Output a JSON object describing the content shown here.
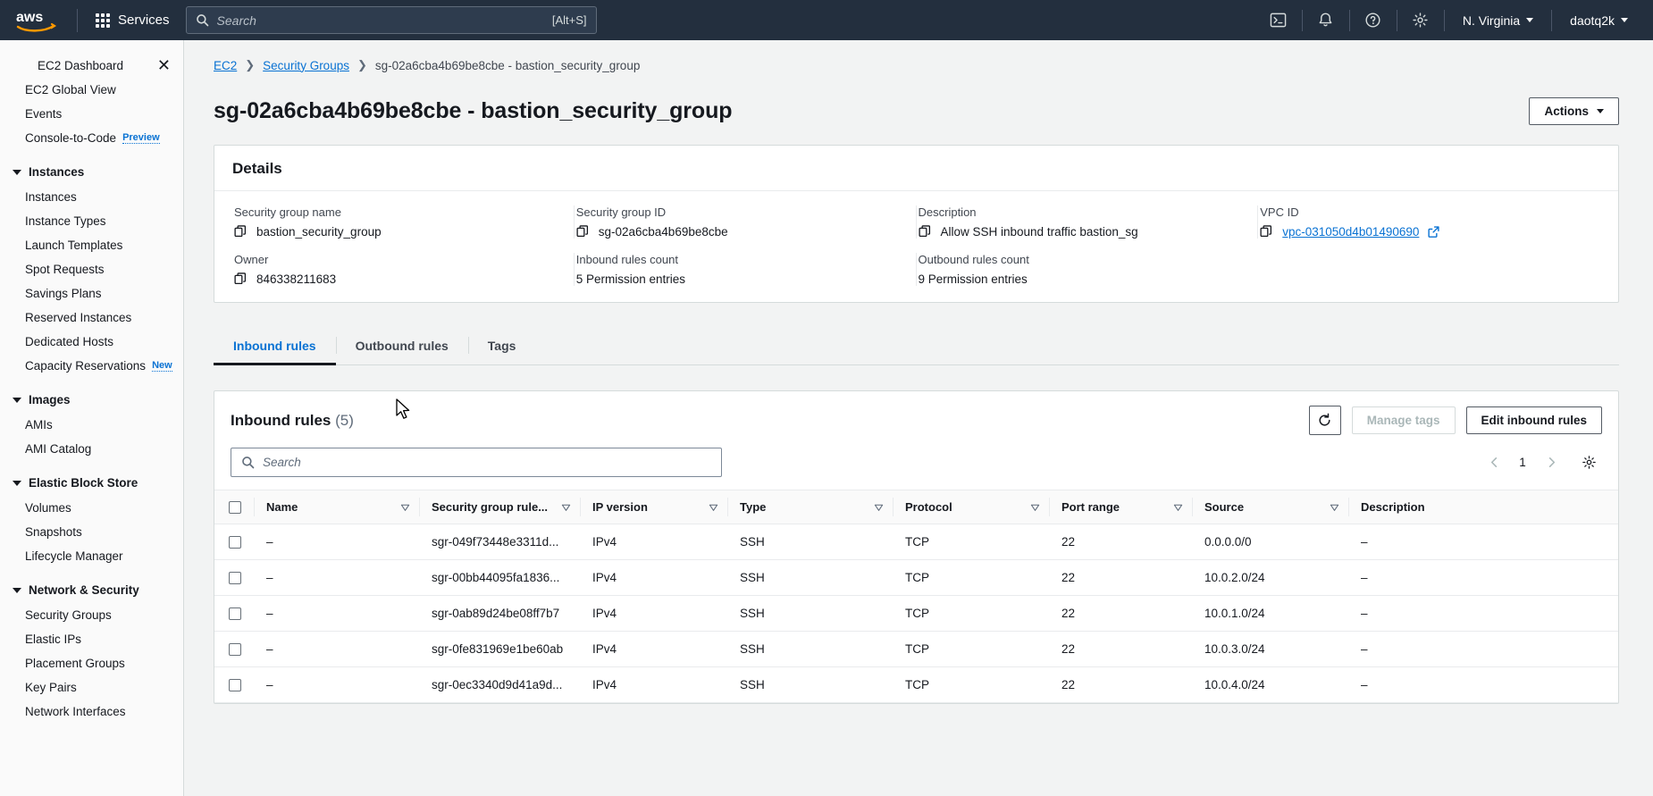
{
  "topnav": {
    "logo_alt": "aws",
    "services_label": "Services",
    "search_placeholder": "Search",
    "search_value": "",
    "search_shortcut": "[Alt+S]",
    "icons": [
      "cloudshell-icon",
      "notifications-bell-icon",
      "help-question-icon",
      "settings-gear-icon"
    ],
    "region_label": "N. Virginia",
    "account_label": "daotq2k"
  },
  "sidebar": {
    "header_item": "EC2 Dashboard",
    "close_label": "✕",
    "links_top": [
      {
        "label": "EC2 Global View"
      },
      {
        "label": "Events"
      },
      {
        "label": "Console-to-Code",
        "badge": "Preview"
      }
    ],
    "groups": [
      {
        "title": "Instances",
        "items": [
          {
            "label": "Instances"
          },
          {
            "label": "Instance Types"
          },
          {
            "label": "Launch Templates"
          },
          {
            "label": "Spot Requests"
          },
          {
            "label": "Savings Plans"
          },
          {
            "label": "Reserved Instances"
          },
          {
            "label": "Dedicated Hosts"
          },
          {
            "label": "Capacity Reservations",
            "badge": "New"
          }
        ]
      },
      {
        "title": "Images",
        "items": [
          {
            "label": "AMIs"
          },
          {
            "label": "AMI Catalog"
          }
        ]
      },
      {
        "title": "Elastic Block Store",
        "items": [
          {
            "label": "Volumes"
          },
          {
            "label": "Snapshots"
          },
          {
            "label": "Lifecycle Manager"
          }
        ]
      },
      {
        "title": "Network & Security",
        "items": [
          {
            "label": "Security Groups"
          },
          {
            "label": "Elastic IPs"
          },
          {
            "label": "Placement Groups"
          },
          {
            "label": "Key Pairs"
          },
          {
            "label": "Network Interfaces"
          }
        ]
      }
    ]
  },
  "breadcrumb": {
    "root": "EC2",
    "parent": "Security Groups",
    "current": "sg-02a6cba4b69be8cbe - bastion_security_group"
  },
  "page": {
    "title": "sg-02a6cba4b69be8cbe - bastion_security_group",
    "actions_label": "Actions"
  },
  "details": {
    "heading": "Details",
    "fields": [
      {
        "label": "Security group name",
        "value": "bastion_security_group",
        "copy": true
      },
      {
        "label": "Security group ID",
        "value": "sg-02a6cba4b69be8cbe",
        "copy": true
      },
      {
        "label": "Description",
        "value": "Allow SSH inbound traffic bastion_sg",
        "copy": true
      },
      {
        "label": "VPC ID",
        "value": "vpc-031050d4b01490690",
        "copy": true,
        "link": true,
        "external": true
      },
      {
        "label": "Owner",
        "value": "846338211683",
        "copy": true
      },
      {
        "label": "Inbound rules count",
        "value": "5 Permission entries",
        "copy": false
      },
      {
        "label": "Outbound rules count",
        "value": "9 Permission entries",
        "copy": false
      }
    ]
  },
  "tabs": [
    {
      "label": "Inbound rules",
      "active": true
    },
    {
      "label": "Outbound rules",
      "active": false
    },
    {
      "label": "Tags",
      "active": false
    }
  ],
  "rules_panel": {
    "title": "Inbound rules",
    "count": "(5)",
    "refresh_icon": "refresh-icon",
    "manage_tags_label": "Manage tags",
    "manage_tags_disabled": true,
    "edit_label": "Edit inbound rules",
    "search_placeholder": "Search",
    "search_value": "",
    "page_number": "1",
    "settings_icon": "settings-gear-icon",
    "columns": [
      "Name",
      "Security group rule...",
      "IP version",
      "Type",
      "Protocol",
      "Port range",
      "Source",
      "Description"
    ],
    "rows": [
      {
        "name": "–",
        "rule_id": "sgr-049f73448e3311d...",
        "ip_version": "IPv4",
        "type": "SSH",
        "protocol": "TCP",
        "port_range": "22",
        "source": "0.0.0.0/0",
        "description": "–"
      },
      {
        "name": "–",
        "rule_id": "sgr-00bb44095fa1836...",
        "ip_version": "IPv4",
        "type": "SSH",
        "protocol": "TCP",
        "port_range": "22",
        "source": "10.0.2.0/24",
        "description": "–"
      },
      {
        "name": "–",
        "rule_id": "sgr-0ab89d24be08ff7b7",
        "ip_version": "IPv4",
        "type": "SSH",
        "protocol": "TCP",
        "port_range": "22",
        "source": "10.0.1.0/24",
        "description": "–"
      },
      {
        "name": "–",
        "rule_id": "sgr-0fe831969e1be60ab",
        "ip_version": "IPv4",
        "type": "SSH",
        "protocol": "TCP",
        "port_range": "22",
        "source": "10.0.3.0/24",
        "description": "–"
      },
      {
        "name": "–",
        "rule_id": "sgr-0ec3340d9d41a9d...",
        "ip_version": "IPv4",
        "type": "SSH",
        "protocol": "TCP",
        "port_range": "22",
        "source": "10.0.4.0/24",
        "description": "–"
      }
    ]
  },
  "colors": {
    "nav_bg": "#232f3e",
    "link_blue": "#0972d3",
    "page_bg": "#f2f3f3",
    "border": "#d5dbdb"
  }
}
